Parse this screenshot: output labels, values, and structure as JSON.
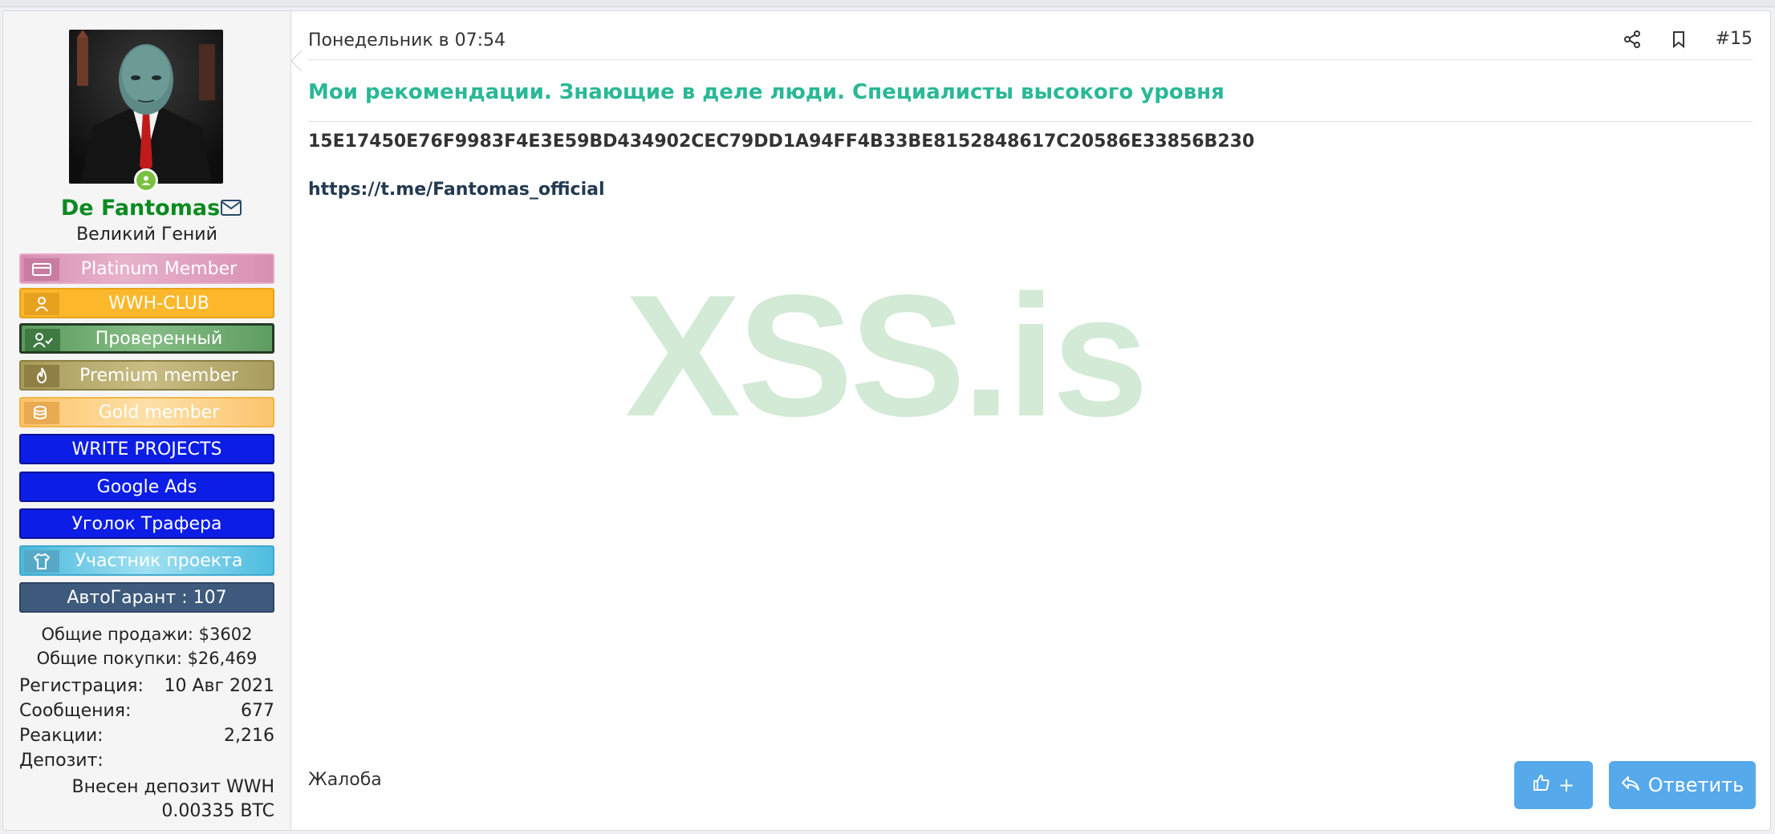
{
  "user": {
    "name": "De Fantomas",
    "title": "Великий Гений",
    "badges": [
      {
        "label": "Platinum Member",
        "icon": "card-icon"
      },
      {
        "label": "WWH-CLUB",
        "icon": "user-icon"
      },
      {
        "label": "Проверенный",
        "icon": "user-check-icon"
      },
      {
        "label": "Premium member",
        "icon": "fire-icon"
      },
      {
        "label": "Gold member",
        "icon": "coins-icon"
      },
      {
        "label": "WRITE PROJECTS"
      },
      {
        "label": "Google Ads"
      },
      {
        "label": "Уголок Трафера"
      },
      {
        "label": "Участник проекта",
        "icon": "shirt-icon"
      },
      {
        "label": "АвтоГарант : 107"
      }
    ],
    "sales": "Общие продажи: $3602",
    "purchases": "Общие покупки: $26,469",
    "stats": [
      {
        "label": "Регистрация:",
        "value": "10 Авг 2021"
      },
      {
        "label": "Сообщения:",
        "value": "677"
      },
      {
        "label": "Реакции:",
        "value": "2,216"
      },
      {
        "label": "Депозит:",
        "value": ""
      }
    ],
    "deposit_line1": "Внесен депозит WWH",
    "deposit_line2": "0.00335 BTC"
  },
  "post": {
    "date": "Понедельник в 07:54",
    "number": "#15",
    "title": "Мои рекомендации. Знающие в деле люди. Специалисты высокого уровня",
    "hash": "15E17450E76F9983F4E3E59BD434902CEC79DD1A94FF4B33BE8152848617C20586E33856B230",
    "link": "https://t.me/Fantomas_official",
    "watermark": "XSS.is",
    "report_label": "Жалоба",
    "like_label": "+",
    "reply_label": "Ответить"
  },
  "colors": {
    "username": "#0a8a20",
    "title": "#2ab896",
    "button": "#56a9ea",
    "watermark": "#d2ead6"
  }
}
